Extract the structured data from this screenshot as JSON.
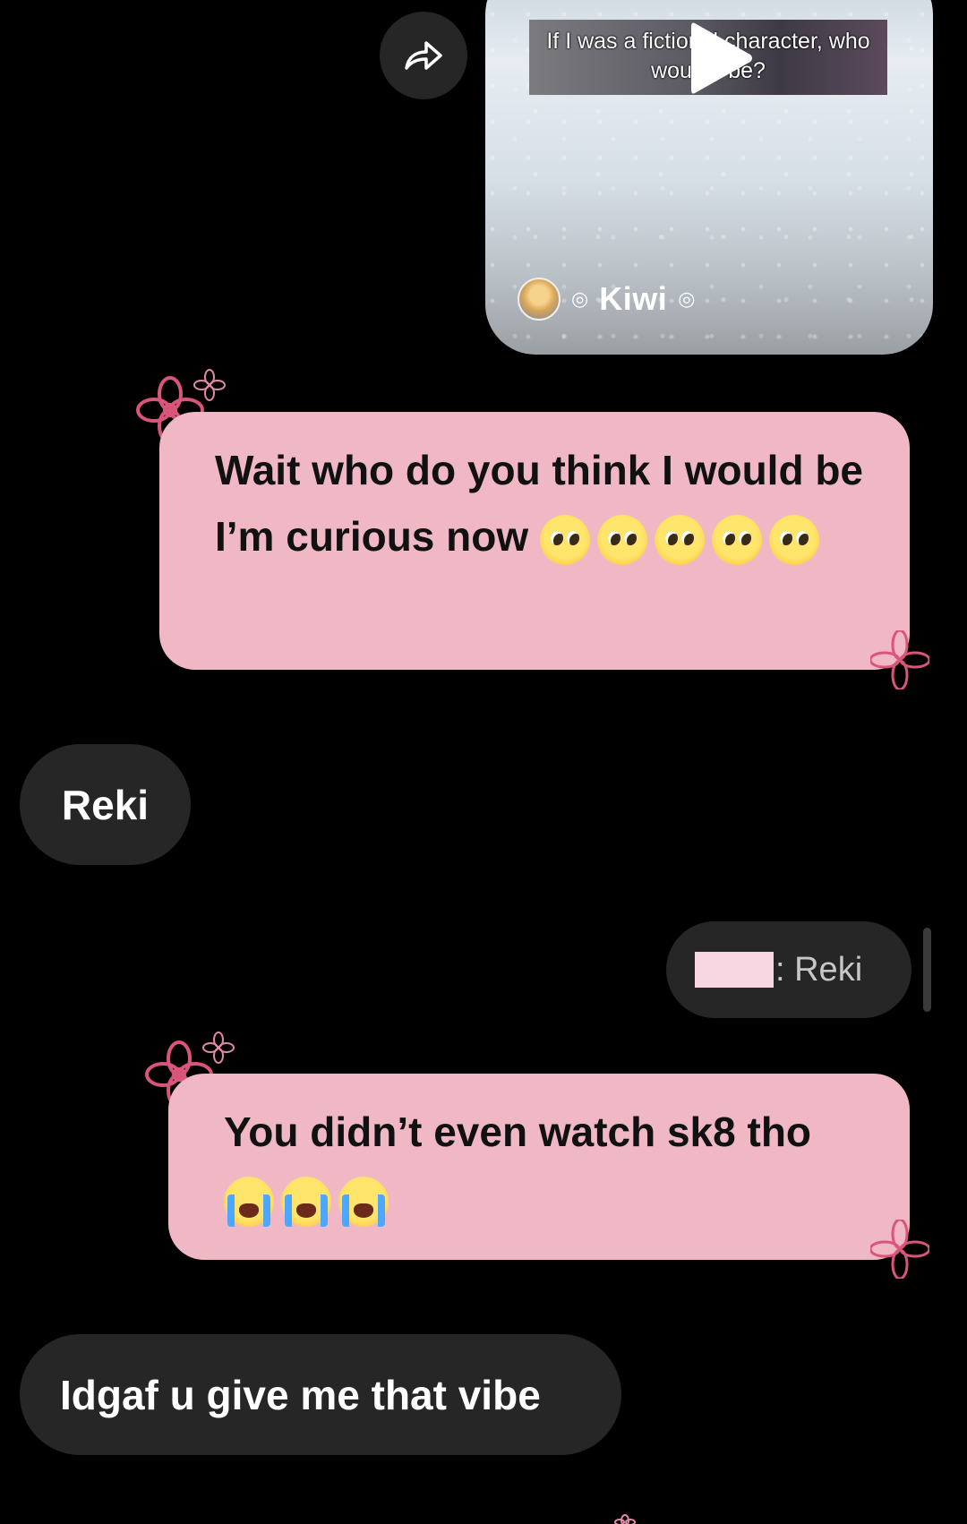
{
  "shared_reel": {
    "caption": "If I was a fictional character, who would I be?",
    "author_name": "Kiwi",
    "author_decoration": "©"
  },
  "messages": [
    {
      "id": "msg1",
      "sender": "me",
      "text": "Wait who do you think I would be I’m curious now",
      "emoji": [
        "pleading-face",
        "pleading-face",
        "pleading-face",
        "pleading-face",
        "pleading-face"
      ]
    },
    {
      "id": "msg2",
      "sender": "them",
      "text": "Reki"
    },
    {
      "id": "msg3",
      "sender": "me",
      "reply_preview": ": Reki"
    },
    {
      "id": "msg4",
      "sender": "me",
      "text": "You didn’t even watch sk8 tho",
      "emoji": [
        "loudly-crying-face",
        "loudly-crying-face",
        "loudly-crying-face"
      ]
    },
    {
      "id": "msg5",
      "sender": "them",
      "text": "Idgaf u give me that vibe"
    }
  ],
  "colors": {
    "background": "#000000",
    "outgoing_bubble": "#f0b7c5",
    "incoming_bubble": "#262626",
    "flower": "#d9557a"
  },
  "icons": [
    "share-arrow-icon",
    "play-icon",
    "pleading-face",
    "loudly-crying-face",
    "flower-icon"
  ]
}
